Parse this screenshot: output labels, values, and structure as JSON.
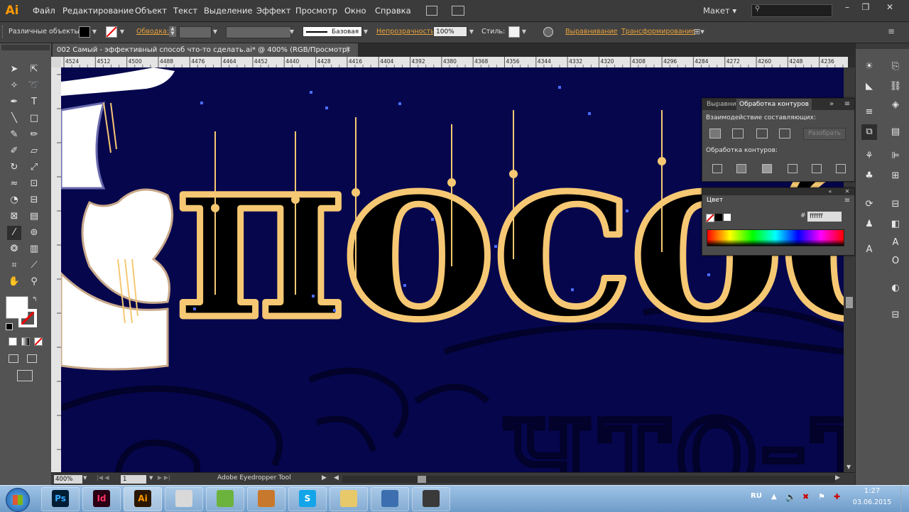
{
  "app": {
    "logo": "Ai"
  },
  "menu": {
    "items": [
      "Файл",
      "Редактирование",
      "Объект",
      "Текст",
      "Выделение",
      "Эффект",
      "Просмотр",
      "Окно",
      "Справка"
    ]
  },
  "workspace": {
    "label": "Макет"
  },
  "control_bar": {
    "selection_label": "Различные объекты",
    "stroke_label": "Обводка:",
    "stroke_profile": "Базовая",
    "opacity_label": "Непрозрачность:",
    "opacity_value": "100%",
    "style_label": "Стиль:",
    "align_label": "Выравнивание",
    "transform_label": "Трансформирование"
  },
  "document": {
    "tab_title": "002 Самый - эффективный способ что-то сделать.ai* @ 400% (RGB/Просмотр)"
  },
  "ruler": {
    "ticks": [
      "4524",
      "4512",
      "4500",
      "4488",
      "4476",
      "4464",
      "4452",
      "4440",
      "4428",
      "4416",
      "4404",
      "4392",
      "4380",
      "4368",
      "4356",
      "4344",
      "4332",
      "4320",
      "4308",
      "4296",
      "4284",
      "4272",
      "4260",
      "4248",
      "4236"
    ]
  },
  "pathfinder_panel": {
    "tabs": [
      "Выравни",
      "Обработка контуров"
    ],
    "shape_modes_label": "Взаимодействие составляющих:",
    "expand_button": "Разобрать",
    "pathfinders_label": "Обработка контуров:"
  },
  "color_panel": {
    "title": "Цвет",
    "hex_prefix": "#",
    "hex_value": "ffffff"
  },
  "status_bar": {
    "zoom": "400%",
    "page": "1",
    "tool_name": "Adobe Eyedropper Tool"
  },
  "artwork": {
    "main_text": "пособ",
    "background_text": "что-т"
  },
  "taskbar": {
    "apps": [
      {
        "name": "Ps",
        "color": "#001d34",
        "fg": "#31a8ff"
      },
      {
        "name": "Id",
        "color": "#2a0014",
        "fg": "#ff3366"
      },
      {
        "name": "Ai",
        "color": "#2b1700",
        "fg": "#ff9a00"
      },
      {
        "name": "",
        "color": "#d9d9d9",
        "fg": "#d33"
      },
      {
        "name": "",
        "color": "#6cb33e",
        "fg": "#fff"
      },
      {
        "name": "",
        "color": "#c8782c",
        "fg": "#fff"
      },
      {
        "name": "S",
        "color": "#12a5e8",
        "fg": "#fff"
      },
      {
        "name": "",
        "color": "#e8c96a",
        "fg": "#fff"
      },
      {
        "name": "",
        "color": "#3d6fb0",
        "fg": "#fff"
      },
      {
        "name": "",
        "color": "#3a3a3a",
        "fg": "#fff"
      }
    ],
    "language": "RU",
    "time": "1:27",
    "date": "03.06.2015"
  },
  "colors": {
    "accent_link": "#e8a33c",
    "canvas_bg": "#06064d",
    "gold_outline": "#f6c873",
    "ai_orange": "#ff9a00"
  }
}
